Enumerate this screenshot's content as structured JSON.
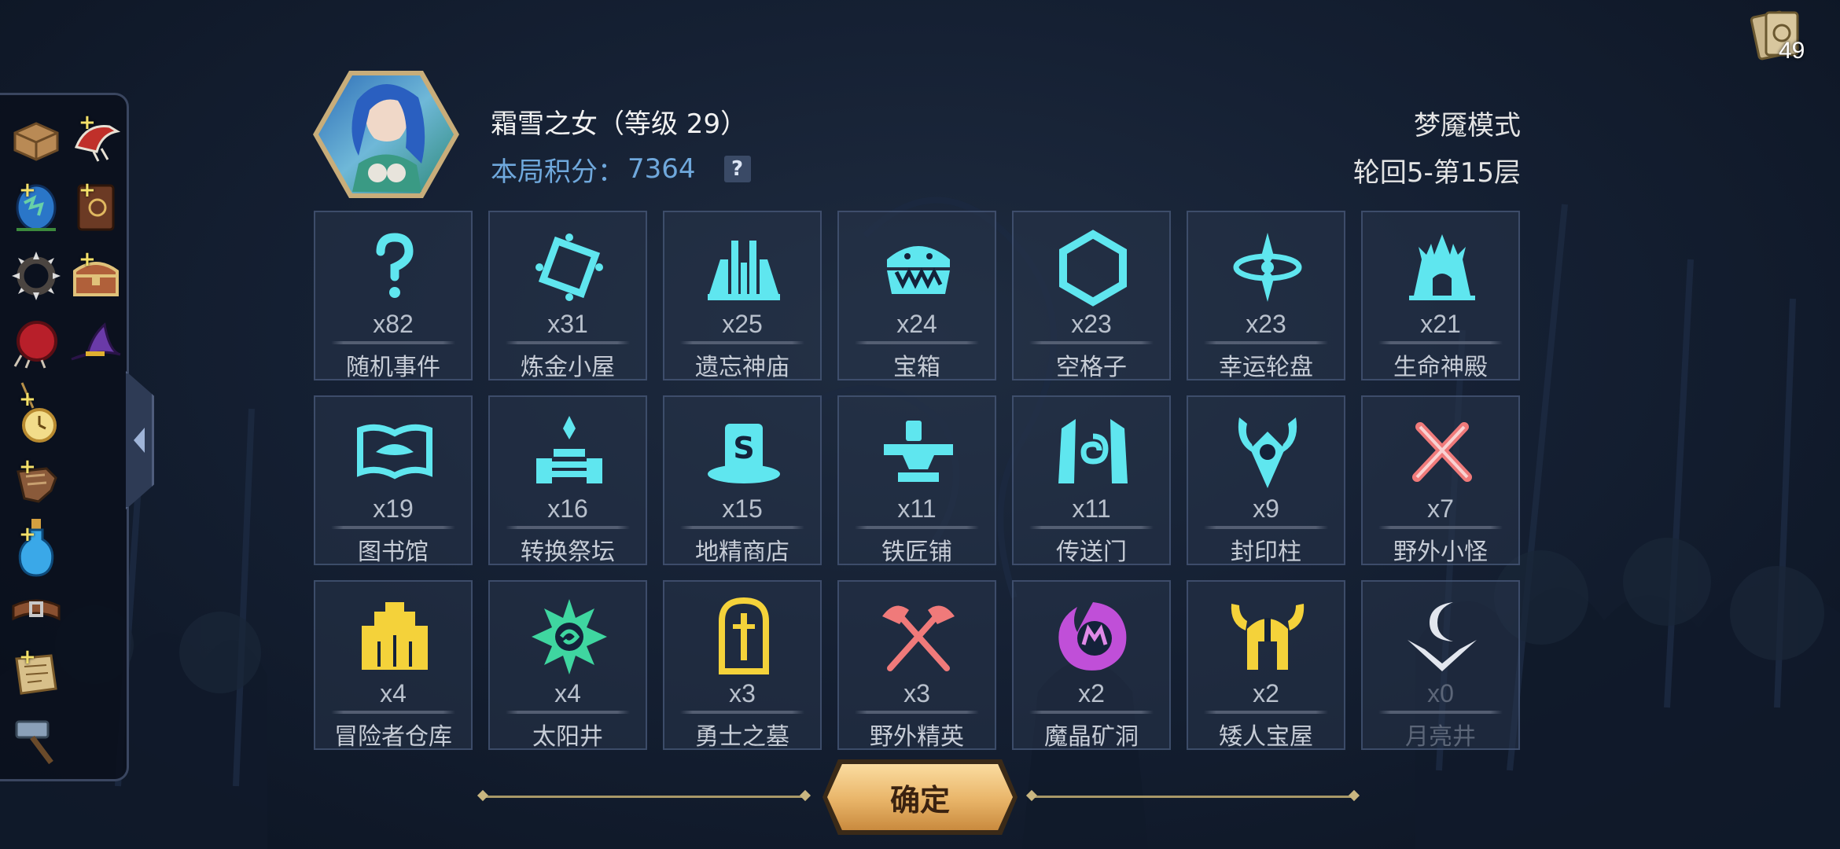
{
  "hero": {
    "name": "霜雪之女（等级 29）",
    "score_label": "本局积分：",
    "score_value": "7364",
    "help_label": "?"
  },
  "mode": {
    "name": "梦魇模式",
    "round": "轮回5-第15层"
  },
  "cards": {
    "count": "49",
    "icon": "card-deck-icon"
  },
  "inventory": [
    {
      "name": "parcel-icon",
      "plus": false
    },
    {
      "name": "red-horn-icon",
      "plus": true
    },
    {
      "name": "dragon-egg-icon",
      "plus": true
    },
    {
      "name": "spell-book-icon",
      "plus": true
    },
    {
      "name": "spiked-collar-icon",
      "plus": false
    },
    {
      "name": "treasure-chest-icon",
      "plus": true
    },
    {
      "name": "red-shield-icon",
      "plus": false
    },
    {
      "name": "wizard-hat-icon",
      "plus": false
    },
    {
      "name": "pocket-watch-icon",
      "plus": true
    },
    {
      "name": "gauntlet-icon",
      "plus": true
    },
    {
      "name": "potion-icon",
      "plus": true
    },
    {
      "name": "belt-icon",
      "plus": false
    },
    {
      "name": "scroll-map-icon",
      "plus": true
    },
    {
      "name": "hammer-icon",
      "plus": false
    }
  ],
  "tiles": [
    {
      "count": "x82",
      "label": "随机事件",
      "icon": "question-mark-icon",
      "color": "#5fe6ef"
    },
    {
      "count": "x31",
      "label": "炼金小屋",
      "icon": "alchemy-ring-icon",
      "color": "#5fe6ef"
    },
    {
      "count": "x25",
      "label": "遗忘神庙",
      "icon": "temple-icon",
      "color": "#5fe6ef"
    },
    {
      "count": "x24",
      "label": "宝箱",
      "icon": "mimic-chest-icon",
      "color": "#5fe6ef"
    },
    {
      "count": "x23",
      "label": "空格子",
      "icon": "hexagon-icon",
      "color": "#5fe6ef"
    },
    {
      "count": "x23",
      "label": "幸运轮盘",
      "icon": "roulette-icon",
      "color": "#5fe6ef"
    },
    {
      "count": "x21",
      "label": "生命神殿",
      "icon": "life-shrine-icon",
      "color": "#5fe6ef"
    },
    {
      "count": "x19",
      "label": "图书馆",
      "icon": "open-book-icon",
      "color": "#5fe6ef"
    },
    {
      "count": "x16",
      "label": "转换祭坛",
      "icon": "altar-icon",
      "color": "#5fe6ef"
    },
    {
      "count": "x15",
      "label": "地精商店",
      "icon": "goblin-hat-icon",
      "color": "#5fe6ef"
    },
    {
      "count": "x11",
      "label": "铁匠铺",
      "icon": "anvil-icon",
      "color": "#5fe6ef"
    },
    {
      "count": "x11",
      "label": "传送门",
      "icon": "portal-icon",
      "color": "#5fe6ef"
    },
    {
      "count": "x9",
      "label": "封印柱",
      "icon": "seal-pillar-icon",
      "color": "#5fe6ef"
    },
    {
      "count": "x7",
      "label": "野外小怪",
      "icon": "crossed-swords-icon",
      "color": "#f07a7a"
    },
    {
      "count": "x4",
      "label": "冒险者仓库",
      "icon": "warehouse-icon",
      "color": "#f4d23a"
    },
    {
      "count": "x4",
      "label": "太阳井",
      "icon": "sun-well-icon",
      "color": "#3fd6a0"
    },
    {
      "count": "x3",
      "label": "勇士之墓",
      "icon": "tombstone-icon",
      "color": "#f4d23a"
    },
    {
      "count": "x3",
      "label": "野外精英",
      "icon": "crossed-axes-icon",
      "color": "#f07a7a"
    },
    {
      "count": "x2",
      "label": "魔晶矿洞",
      "icon": "crystal-cave-icon",
      "color": "#c04fd8"
    },
    {
      "count": "x2",
      "label": "矮人宝屋",
      "icon": "dwarf-helmet-icon",
      "color": "#f4d23a"
    },
    {
      "count": "x0",
      "label": "月亮井",
      "icon": "moon-well-icon",
      "color": "#d8dce6"
    }
  ],
  "confirm": {
    "label": "确定"
  }
}
